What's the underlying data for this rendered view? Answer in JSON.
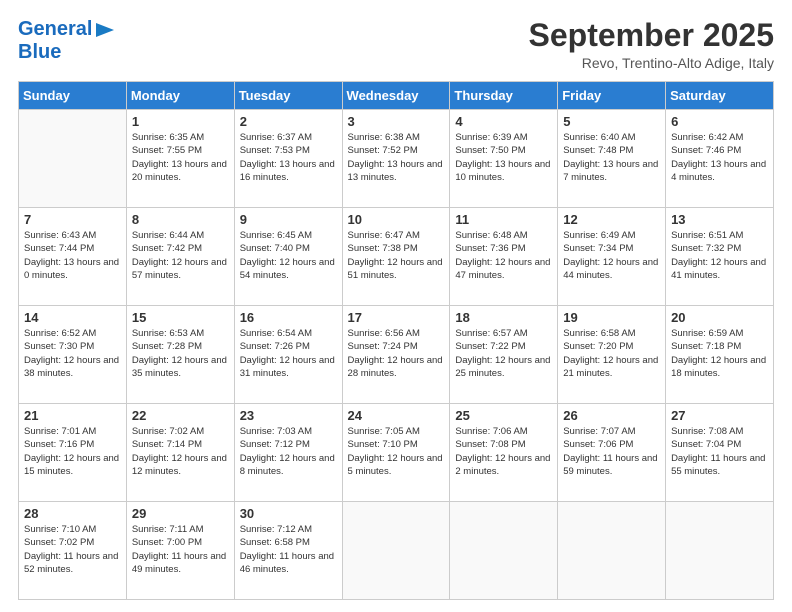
{
  "header": {
    "logo_top": "General",
    "logo_bottom": "Blue",
    "month_title": "September 2025",
    "location": "Revo, Trentino-Alto Adige, Italy"
  },
  "weekdays": [
    "Sunday",
    "Monday",
    "Tuesday",
    "Wednesday",
    "Thursday",
    "Friday",
    "Saturday"
  ],
  "weeks": [
    [
      {
        "day": "",
        "sunrise": "",
        "sunset": "",
        "daylight": ""
      },
      {
        "day": "1",
        "sunrise": "Sunrise: 6:35 AM",
        "sunset": "Sunset: 7:55 PM",
        "daylight": "Daylight: 13 hours and 20 minutes."
      },
      {
        "day": "2",
        "sunrise": "Sunrise: 6:37 AM",
        "sunset": "Sunset: 7:53 PM",
        "daylight": "Daylight: 13 hours and 16 minutes."
      },
      {
        "day": "3",
        "sunrise": "Sunrise: 6:38 AM",
        "sunset": "Sunset: 7:52 PM",
        "daylight": "Daylight: 13 hours and 13 minutes."
      },
      {
        "day": "4",
        "sunrise": "Sunrise: 6:39 AM",
        "sunset": "Sunset: 7:50 PM",
        "daylight": "Daylight: 13 hours and 10 minutes."
      },
      {
        "day": "5",
        "sunrise": "Sunrise: 6:40 AM",
        "sunset": "Sunset: 7:48 PM",
        "daylight": "Daylight: 13 hours and 7 minutes."
      },
      {
        "day": "6",
        "sunrise": "Sunrise: 6:42 AM",
        "sunset": "Sunset: 7:46 PM",
        "daylight": "Daylight: 13 hours and 4 minutes."
      }
    ],
    [
      {
        "day": "7",
        "sunrise": "Sunrise: 6:43 AM",
        "sunset": "Sunset: 7:44 PM",
        "daylight": "Daylight: 13 hours and 0 minutes."
      },
      {
        "day": "8",
        "sunrise": "Sunrise: 6:44 AM",
        "sunset": "Sunset: 7:42 PM",
        "daylight": "Daylight: 12 hours and 57 minutes."
      },
      {
        "day": "9",
        "sunrise": "Sunrise: 6:45 AM",
        "sunset": "Sunset: 7:40 PM",
        "daylight": "Daylight: 12 hours and 54 minutes."
      },
      {
        "day": "10",
        "sunrise": "Sunrise: 6:47 AM",
        "sunset": "Sunset: 7:38 PM",
        "daylight": "Daylight: 12 hours and 51 minutes."
      },
      {
        "day": "11",
        "sunrise": "Sunrise: 6:48 AM",
        "sunset": "Sunset: 7:36 PM",
        "daylight": "Daylight: 12 hours and 47 minutes."
      },
      {
        "day": "12",
        "sunrise": "Sunrise: 6:49 AM",
        "sunset": "Sunset: 7:34 PM",
        "daylight": "Daylight: 12 hours and 44 minutes."
      },
      {
        "day": "13",
        "sunrise": "Sunrise: 6:51 AM",
        "sunset": "Sunset: 7:32 PM",
        "daylight": "Daylight: 12 hours and 41 minutes."
      }
    ],
    [
      {
        "day": "14",
        "sunrise": "Sunrise: 6:52 AM",
        "sunset": "Sunset: 7:30 PM",
        "daylight": "Daylight: 12 hours and 38 minutes."
      },
      {
        "day": "15",
        "sunrise": "Sunrise: 6:53 AM",
        "sunset": "Sunset: 7:28 PM",
        "daylight": "Daylight: 12 hours and 35 minutes."
      },
      {
        "day": "16",
        "sunrise": "Sunrise: 6:54 AM",
        "sunset": "Sunset: 7:26 PM",
        "daylight": "Daylight: 12 hours and 31 minutes."
      },
      {
        "day": "17",
        "sunrise": "Sunrise: 6:56 AM",
        "sunset": "Sunset: 7:24 PM",
        "daylight": "Daylight: 12 hours and 28 minutes."
      },
      {
        "day": "18",
        "sunrise": "Sunrise: 6:57 AM",
        "sunset": "Sunset: 7:22 PM",
        "daylight": "Daylight: 12 hours and 25 minutes."
      },
      {
        "day": "19",
        "sunrise": "Sunrise: 6:58 AM",
        "sunset": "Sunset: 7:20 PM",
        "daylight": "Daylight: 12 hours and 21 minutes."
      },
      {
        "day": "20",
        "sunrise": "Sunrise: 6:59 AM",
        "sunset": "Sunset: 7:18 PM",
        "daylight": "Daylight: 12 hours and 18 minutes."
      }
    ],
    [
      {
        "day": "21",
        "sunrise": "Sunrise: 7:01 AM",
        "sunset": "Sunset: 7:16 PM",
        "daylight": "Daylight: 12 hours and 15 minutes."
      },
      {
        "day": "22",
        "sunrise": "Sunrise: 7:02 AM",
        "sunset": "Sunset: 7:14 PM",
        "daylight": "Daylight: 12 hours and 12 minutes."
      },
      {
        "day": "23",
        "sunrise": "Sunrise: 7:03 AM",
        "sunset": "Sunset: 7:12 PM",
        "daylight": "Daylight: 12 hours and 8 minutes."
      },
      {
        "day": "24",
        "sunrise": "Sunrise: 7:05 AM",
        "sunset": "Sunset: 7:10 PM",
        "daylight": "Daylight: 12 hours and 5 minutes."
      },
      {
        "day": "25",
        "sunrise": "Sunrise: 7:06 AM",
        "sunset": "Sunset: 7:08 PM",
        "daylight": "Daylight: 12 hours and 2 minutes."
      },
      {
        "day": "26",
        "sunrise": "Sunrise: 7:07 AM",
        "sunset": "Sunset: 7:06 PM",
        "daylight": "Daylight: 11 hours and 59 minutes."
      },
      {
        "day": "27",
        "sunrise": "Sunrise: 7:08 AM",
        "sunset": "Sunset: 7:04 PM",
        "daylight": "Daylight: 11 hours and 55 minutes."
      }
    ],
    [
      {
        "day": "28",
        "sunrise": "Sunrise: 7:10 AM",
        "sunset": "Sunset: 7:02 PM",
        "daylight": "Daylight: 11 hours and 52 minutes."
      },
      {
        "day": "29",
        "sunrise": "Sunrise: 7:11 AM",
        "sunset": "Sunset: 7:00 PM",
        "daylight": "Daylight: 11 hours and 49 minutes."
      },
      {
        "day": "30",
        "sunrise": "Sunrise: 7:12 AM",
        "sunset": "Sunset: 6:58 PM",
        "daylight": "Daylight: 11 hours and 46 minutes."
      },
      {
        "day": "",
        "sunrise": "",
        "sunset": "",
        "daylight": ""
      },
      {
        "day": "",
        "sunrise": "",
        "sunset": "",
        "daylight": ""
      },
      {
        "day": "",
        "sunrise": "",
        "sunset": "",
        "daylight": ""
      },
      {
        "day": "",
        "sunrise": "",
        "sunset": "",
        "daylight": ""
      }
    ]
  ]
}
